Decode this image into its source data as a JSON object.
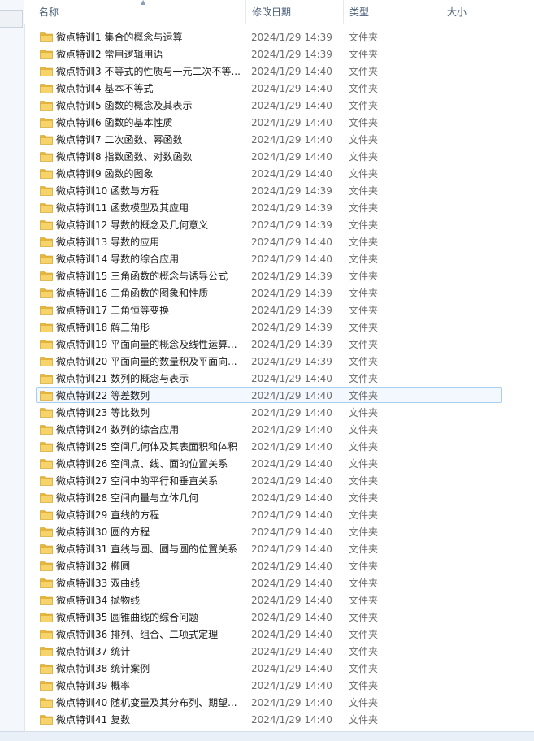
{
  "columns": {
    "name": "名称",
    "date": "修改日期",
    "type": "类型",
    "size": "大小"
  },
  "sort_indicator": "▲",
  "files": [
    {
      "name": "微点特训1 集合的概念与运算",
      "date": "2024/1/29 14:39",
      "type": "文件夹"
    },
    {
      "name": "微点特训2 常用逻辑用语",
      "date": "2024/1/29 14:39",
      "type": "文件夹"
    },
    {
      "name": "微点特训3 不等式的性质与一元二次不等...",
      "date": "2024/1/29 14:40",
      "type": "文件夹"
    },
    {
      "name": "微点特训4 基本不等式",
      "date": "2024/1/29 14:40",
      "type": "文件夹"
    },
    {
      "name": "微点特训5 函数的概念及其表示",
      "date": "2024/1/29 14:40",
      "type": "文件夹"
    },
    {
      "name": "微点特训6 函数的基本性质",
      "date": "2024/1/29 14:40",
      "type": "文件夹"
    },
    {
      "name": "微点特训7 二次函数、幂函数",
      "date": "2024/1/29 14:40",
      "type": "文件夹"
    },
    {
      "name": "微点特训8 指数函数、对数函数",
      "date": "2024/1/29 14:40",
      "type": "文件夹"
    },
    {
      "name": "微点特训9 函数的图象",
      "date": "2024/1/29 14:40",
      "type": "文件夹"
    },
    {
      "name": "微点特训10 函数与方程",
      "date": "2024/1/29 14:39",
      "type": "文件夹"
    },
    {
      "name": "微点特训11 函数模型及其应用",
      "date": "2024/1/29 14:39",
      "type": "文件夹"
    },
    {
      "name": "微点特训12 导数的概念及几何意义",
      "date": "2024/1/29 14:39",
      "type": "文件夹"
    },
    {
      "name": "微点特训13 导数的应用",
      "date": "2024/1/29 14:40",
      "type": "文件夹"
    },
    {
      "name": "微点特训14 导数的综合应用",
      "date": "2024/1/29 14:40",
      "type": "文件夹"
    },
    {
      "name": "微点特训15 三角函数的概念与诱导公式",
      "date": "2024/1/29 14:39",
      "type": "文件夹"
    },
    {
      "name": "微点特训16 三角函数的图象和性质",
      "date": "2024/1/29 14:39",
      "type": "文件夹"
    },
    {
      "name": "微点特训17 三角恒等变换",
      "date": "2024/1/29 14:39",
      "type": "文件夹"
    },
    {
      "name": "微点特训18 解三角形",
      "date": "2024/1/29 14:39",
      "type": "文件夹"
    },
    {
      "name": "微点特训19 平面向量的概念及线性运算...",
      "date": "2024/1/29 14:39",
      "type": "文件夹"
    },
    {
      "name": "微点特训20 平面向量的数量积及平面向...",
      "date": "2024/1/29 14:39",
      "type": "文件夹"
    },
    {
      "name": "微点特训21 数列的概念与表示",
      "date": "2024/1/29 14:40",
      "type": "文件夹"
    },
    {
      "name": "微点特训22 等差数列",
      "date": "2024/1/29 14:40",
      "type": "文件夹",
      "selected": true
    },
    {
      "name": "微点特训23 等比数列",
      "date": "2024/1/29 14:40",
      "type": "文件夹"
    },
    {
      "name": "微点特训24 数列的综合应用",
      "date": "2024/1/29 14:40",
      "type": "文件夹"
    },
    {
      "name": "微点特训25 空间几何体及其表面积和体积",
      "date": "2024/1/29 14:40",
      "type": "文件夹"
    },
    {
      "name": "微点特训26 空间点、线、面的位置关系",
      "date": "2024/1/29 14:40",
      "type": "文件夹"
    },
    {
      "name": "微点特训27 空间中的平行和垂直关系",
      "date": "2024/1/29 14:40",
      "type": "文件夹"
    },
    {
      "name": "微点特训28 空间向量与立体几何",
      "date": "2024/1/29 14:40",
      "type": "文件夹"
    },
    {
      "name": "微点特训29 直线的方程",
      "date": "2024/1/29 14:40",
      "type": "文件夹"
    },
    {
      "name": "微点特训30 圆的方程",
      "date": "2024/1/29 14:40",
      "type": "文件夹"
    },
    {
      "name": "微点特训31 直线与圆、圆与圆的位置关系",
      "date": "2024/1/29 14:40",
      "type": "文件夹"
    },
    {
      "name": "微点特训32 椭圆",
      "date": "2024/1/29 14:40",
      "type": "文件夹"
    },
    {
      "name": "微点特训33 双曲线",
      "date": "2024/1/29 14:40",
      "type": "文件夹"
    },
    {
      "name": "微点特训34 抛物线",
      "date": "2024/1/29 14:40",
      "type": "文件夹"
    },
    {
      "name": "微点特训35 圆锥曲线的综合问题",
      "date": "2024/1/29 14:40",
      "type": "文件夹"
    },
    {
      "name": "微点特训36 排列、组合、二项式定理",
      "date": "2024/1/29 14:40",
      "type": "文件夹"
    },
    {
      "name": "微点特训37 统计",
      "date": "2024/1/29 14:40",
      "type": "文件夹"
    },
    {
      "name": "微点特训38 统计案例",
      "date": "2024/1/29 14:40",
      "type": "文件夹"
    },
    {
      "name": "微点特训39 概率",
      "date": "2024/1/29 14:40",
      "type": "文件夹"
    },
    {
      "name": "微点特训40 随机变量及其分布列、期望...",
      "date": "2024/1/29 14:40",
      "type": "文件夹"
    },
    {
      "name": "微点特训41 复数",
      "date": "2024/1/29 14:40",
      "type": "文件夹"
    }
  ],
  "colors": {
    "folder_body": "#e8b73a",
    "folder_front": "#f6d36b",
    "selection_bg": "#f2f8fe",
    "selection_border": "#a9cdf0"
  }
}
